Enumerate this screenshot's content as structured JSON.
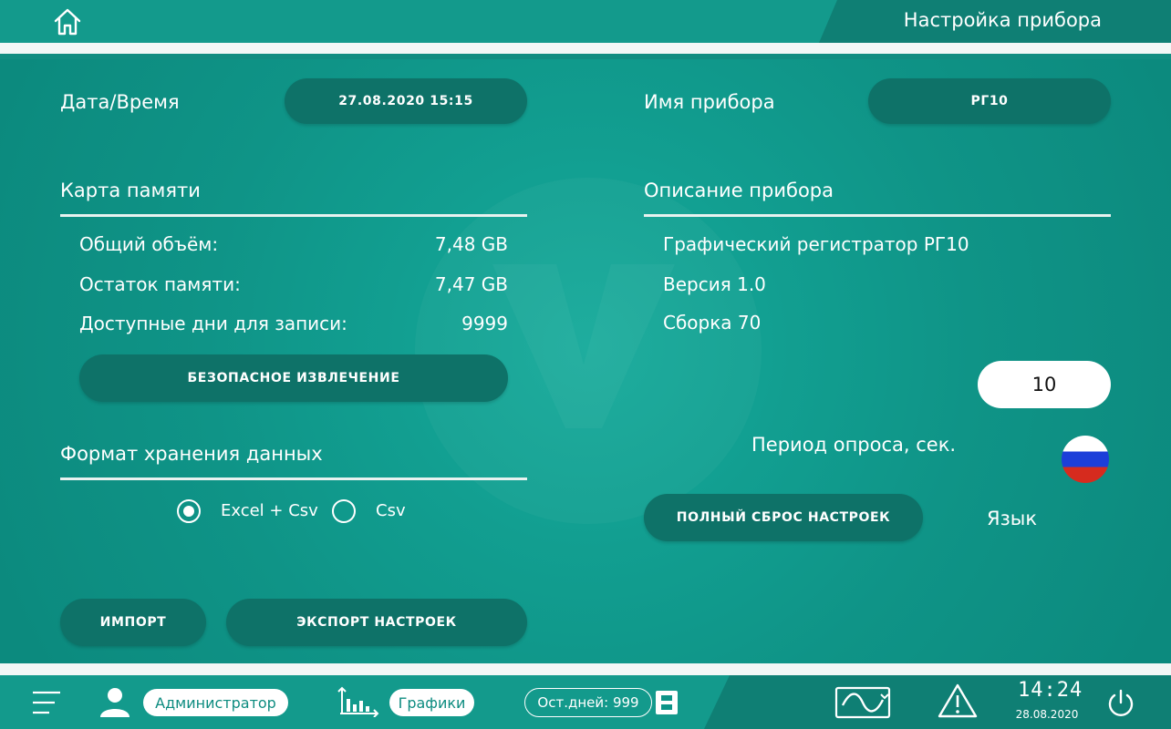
{
  "header": {
    "title": "Настройка прибора"
  },
  "datetime": {
    "label": "Дата/Время",
    "value": "27.08.2020 15:15"
  },
  "device_name": {
    "label": "Имя прибора",
    "value": "РГ10"
  },
  "memory_card": {
    "title": "Карта памяти",
    "rows": [
      {
        "label": "Общий объём:",
        "value": "7,48 GB"
      },
      {
        "label": "Остаток памяти:",
        "value": "7,47 GB"
      },
      {
        "label": "Доступные дни для записи:",
        "value": "9999"
      }
    ],
    "eject_button": "БЕЗОПАСНОЕ ИЗВЛЕЧЕНИЕ"
  },
  "device_description": {
    "title": "Описание прибора",
    "lines": [
      "Графический регистратор РГ10",
      "Версия 1.0",
      "Сборка 70"
    ]
  },
  "storage_format": {
    "title": "Формат хранения данных",
    "options": [
      {
        "label": "Excel + Csv",
        "selected": true
      },
      {
        "label": "Csv",
        "selected": false
      }
    ]
  },
  "poll_period": {
    "label": "Период опроса, сек.",
    "value": "10"
  },
  "reset_button": "ПОЛНЫЙ СБРОС НАСТРОЕК",
  "language": {
    "label": "Язык",
    "flag_icon": "russia-flag-icon"
  },
  "import_button": "ИМПОРТ",
  "export_button": "ЭКСПОРТ НАСТРОЕК",
  "bottom_bar": {
    "user_label": "Администратор",
    "charts_label": "Графики",
    "days_left": "Ост.дней: 999",
    "time": "14:24",
    "date": "28.08.2020"
  },
  "colors": {
    "background": "#0d9488",
    "pill": "#0e7268",
    "header_dark": "#0f7f74"
  }
}
